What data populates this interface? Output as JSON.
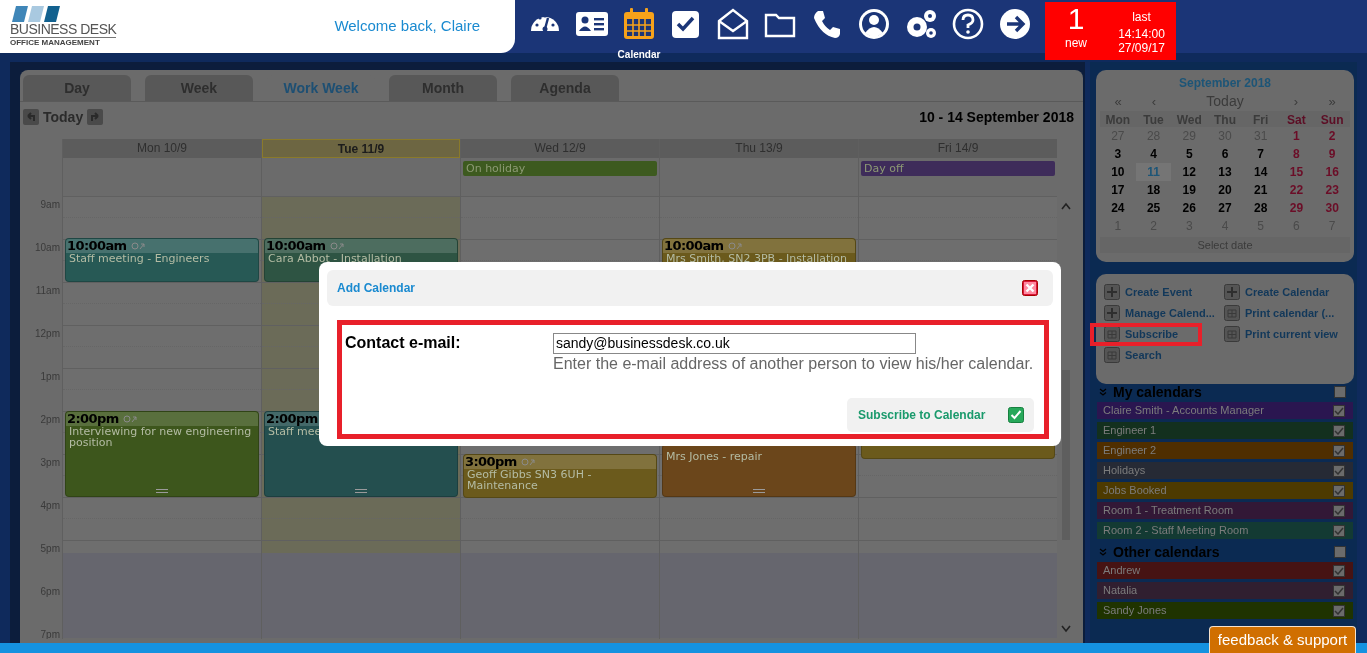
{
  "header": {
    "logo": {
      "name": "BUSINESS DESK",
      "tagline": "OFFICE MANAGEMENT"
    },
    "welcome": "Welcome back, Claire",
    "nav": [
      {
        "selected": false
      },
      {
        "selected": false
      },
      {
        "label": "Calendar",
        "selected": true
      },
      {
        "selected": false
      },
      {
        "selected": false
      },
      {
        "selected": false
      },
      {
        "selected": false
      },
      {
        "selected": false
      },
      {
        "selected": false
      },
      {
        "selected": false
      },
      {
        "selected": false
      }
    ],
    "notifications": {
      "count": "1",
      "count_label": "new",
      "last_label": "last",
      "time": "14:14:00",
      "date": "27/09/17"
    }
  },
  "calendar": {
    "tabs": [
      {
        "label": "Day",
        "selected": false
      },
      {
        "label": "Week",
        "selected": false
      },
      {
        "label": "Work Week",
        "selected": true
      },
      {
        "label": "Month",
        "selected": false
      },
      {
        "label": "Agenda",
        "selected": false
      }
    ],
    "today": "Today",
    "range": "10 - 14 September 2018",
    "hours": [
      "9am",
      "10am",
      "11am",
      "12pm",
      "1pm",
      "2pm",
      "3pm",
      "4pm",
      "5pm",
      "6pm",
      "7pm"
    ],
    "days": [
      {
        "label": "Mon 10/9",
        "selected": false,
        "events": [
          {
            "time": "10:00am",
            "title": "Staff meeting - Engineers",
            "color": "#275955"
          },
          {
            "time": "2:00pm",
            "title": "Interviewing for new engineering position",
            "color": "#3d561c"
          }
        ]
      },
      {
        "label": "Tue 11/9",
        "selected": true,
        "events": [
          {
            "time": "10:00am",
            "title": "Cara Abbot - Installation",
            "color": "#2e5443"
          },
          {
            "time": "2:00pm",
            "title": "Staff mee",
            "color": "#244f4f"
          }
        ]
      },
      {
        "label": "Wed 12/9",
        "selected": false,
        "all_day": {
          "title": "On holiday",
          "color": "#3d5a1f"
        },
        "events": [
          {
            "time": "3:00pm",
            "title": "Geoff Gibbs SN3 6UH - Maintenance",
            "color": "#6b5a1c"
          }
        ]
      },
      {
        "label": "Thu 13/9",
        "selected": false,
        "events": [
          {
            "time": "10:00am",
            "title": "Mrs Smith, SN2 3PB - Installation",
            "color": "#6b5a1c"
          },
          {
            "title": "Mrs Jones - repair",
            "color": "#6b461b"
          }
        ]
      },
      {
        "label": "Fri 14/9",
        "selected": false,
        "all_day": {
          "title": "Day off",
          "color": "#3e2c5a"
        },
        "events": [
          {
            "color": "#6b5a1c"
          }
        ]
      }
    ]
  },
  "mini_calendar": {
    "title": "September 2018",
    "nav": [
      "«",
      "‹",
      "Today",
      "›",
      "»"
    ],
    "weekdays": [
      "Mon",
      "Tue",
      "Wed",
      "Thu",
      "Fri",
      "Sat",
      "Sun"
    ],
    "weeks": [
      [
        {
          "label": "27",
          "outside": true,
          "selected": false
        },
        {
          "label": "28",
          "outside": true,
          "selected": false
        },
        {
          "label": "29",
          "outside": true,
          "selected": false
        },
        {
          "label": "30",
          "outside": true,
          "selected": false
        },
        {
          "label": "31",
          "outside": true,
          "selected": false
        },
        {
          "label": "1",
          "outside": false,
          "selected": false
        },
        {
          "label": "2",
          "outside": false,
          "selected": false
        }
      ],
      [
        {
          "label": "3",
          "outside": false,
          "selected": false
        },
        {
          "label": "4",
          "outside": false,
          "selected": false
        },
        {
          "label": "5",
          "outside": false,
          "selected": false
        },
        {
          "label": "6",
          "outside": false,
          "selected": false
        },
        {
          "label": "7",
          "outside": false,
          "selected": false
        },
        {
          "label": "8",
          "outside": false,
          "selected": false
        },
        {
          "label": "9",
          "outside": false,
          "selected": false
        }
      ],
      [
        {
          "label": "10",
          "outside": false,
          "selected": false
        },
        {
          "label": "11",
          "outside": false,
          "selected": true
        },
        {
          "label": "12",
          "outside": false,
          "selected": false
        },
        {
          "label": "13",
          "outside": false,
          "selected": false
        },
        {
          "label": "14",
          "outside": false,
          "selected": false
        },
        {
          "label": "15",
          "outside": false,
          "selected": false
        },
        {
          "label": "16",
          "outside": false,
          "selected": false
        }
      ],
      [
        {
          "label": "17",
          "outside": false,
          "selected": false
        },
        {
          "label": "18",
          "outside": false,
          "selected": false
        },
        {
          "label": "19",
          "outside": false,
          "selected": false
        },
        {
          "label": "20",
          "outside": false,
          "selected": false
        },
        {
          "label": "21",
          "outside": false,
          "selected": false
        },
        {
          "label": "22",
          "outside": false,
          "selected": false
        },
        {
          "label": "23",
          "outside": false,
          "selected": false
        }
      ],
      [
        {
          "label": "24",
          "outside": false,
          "selected": false
        },
        {
          "label": "25",
          "outside": false,
          "selected": false
        },
        {
          "label": "26",
          "outside": false,
          "selected": false
        },
        {
          "label": "27",
          "outside": false,
          "selected": false
        },
        {
          "label": "28",
          "outside": false,
          "selected": false
        },
        {
          "label": "29",
          "outside": false,
          "selected": false
        },
        {
          "label": "30",
          "outside": false,
          "selected": false
        }
      ],
      [
        {
          "label": "1",
          "outside": true,
          "selected": false
        },
        {
          "label": "2",
          "outside": true,
          "selected": false
        },
        {
          "label": "3",
          "outside": true,
          "selected": false
        },
        {
          "label": "4",
          "outside": true,
          "selected": false
        },
        {
          "label": "5",
          "outside": true,
          "selected": false
        },
        {
          "label": "6",
          "outside": true,
          "selected": false
        },
        {
          "label": "7",
          "outside": true,
          "selected": false
        }
      ]
    ],
    "footer": "Select date"
  },
  "actions": {
    "left": [
      {
        "label": "Create Event",
        "kind": "plus"
      },
      {
        "label": "Manage Calend...",
        "kind": "plus"
      },
      {
        "label": "Subscribe",
        "kind": "grid",
        "highlighted": true
      },
      {
        "label": "Search",
        "kind": "grid"
      }
    ],
    "right": [
      {
        "label": "Create Calendar",
        "kind": "plus"
      },
      {
        "label": "Print calendar (...",
        "kind": "grid"
      },
      {
        "label": "Print current view",
        "kind": "grid"
      }
    ]
  },
  "calendar_groups": [
    {
      "title": "My calendars",
      "checked": false,
      "items": [
        {
          "label": "Claire Smith - Accounts Manager",
          "color": "#2a1650",
          "checked": true
        },
        {
          "label": "Engineer 1",
          "color": "#13301e",
          "checked": true
        },
        {
          "label": "Engineer 2",
          "color": "#4f2e00",
          "checked": true
        },
        {
          "label": "Holidays",
          "color": "#262a35",
          "checked": true
        },
        {
          "label": "Jobs Booked",
          "color": "#4d3a00",
          "checked": true
        },
        {
          "label": "Room 1 - Treatment Room",
          "color": "#321836",
          "checked": true
        },
        {
          "label": "Room 2 - Staff Meeting Room",
          "color": "#133a33",
          "checked": true
        }
      ]
    },
    {
      "title": "Other calendars",
      "checked": false,
      "items": [
        {
          "label": "Andrew",
          "color": "#461313",
          "checked": true
        },
        {
          "label": "Natalia",
          "color": "#301f30",
          "checked": true
        },
        {
          "label": "Sandy Jones",
          "color": "#1f3300",
          "checked": true
        }
      ]
    }
  ],
  "dialog": {
    "title": "Add Calendar",
    "field_label": "Contact e-mail:",
    "value": "sandy@businessdesk.co.uk",
    "hint": "Enter the e-mail address of another person to view his/her calendar.",
    "button": "Subscribe to Calendar"
  },
  "feedback": "feedback & support"
}
